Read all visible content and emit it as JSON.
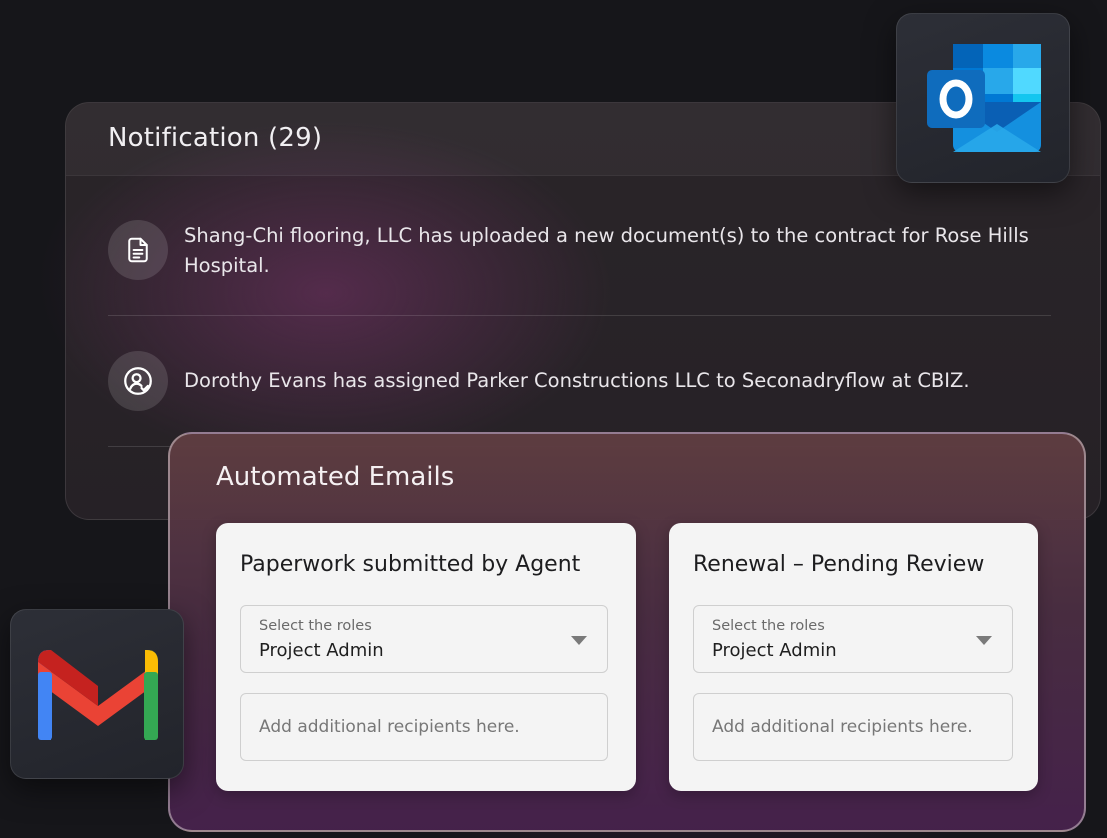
{
  "notifications": {
    "title": "Notification (29)",
    "items": [
      {
        "icon": "document-icon",
        "text": "Shang-Chi flooring, LLC has uploaded a new document(s) to the contract for Rose Hills Hospital."
      },
      {
        "icon": "user-assign-icon",
        "text": "Dorothy Evans has assigned Parker Constructions LLC to Seconadryflow at CBIZ."
      }
    ]
  },
  "apps": {
    "outlook": {
      "icon": "outlook-logo",
      "letter": "O",
      "color": "#0f6cbd"
    },
    "gmail": {
      "icon": "gmail-logo"
    }
  },
  "automated_emails": {
    "title": "Automated Emails",
    "cards": [
      {
        "title": "Paperwork submitted by Agent",
        "select_label": "Select the roles",
        "select_value": "Project Admin",
        "recipients_placeholder": "Add additional recipients here."
      },
      {
        "title": "Renewal – Pending Review",
        "select_label": "Select the roles",
        "select_value": "Project Admin",
        "recipients_placeholder": "Add additional recipients here."
      }
    ]
  },
  "colors": {
    "background": "#16161a",
    "panel": "#2a2529",
    "card": "#f4f4f4",
    "accent_purple": "#6e2d6e"
  }
}
